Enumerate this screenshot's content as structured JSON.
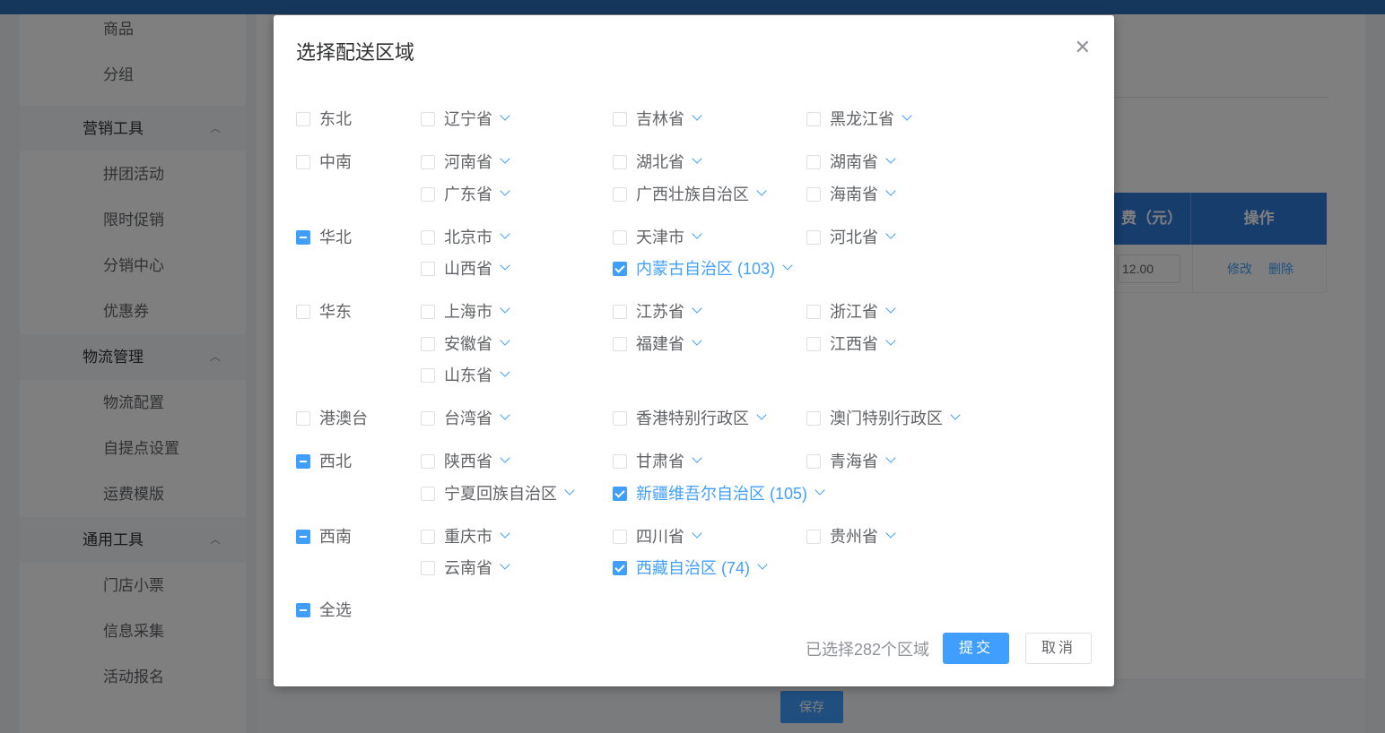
{
  "sidebar": {
    "items": [
      {
        "label": "商品",
        "type": "item"
      },
      {
        "label": "分组",
        "type": "item"
      },
      {
        "label": "营销工具",
        "type": "group"
      },
      {
        "label": "拼团活动",
        "type": "item"
      },
      {
        "label": "限时促销",
        "type": "item"
      },
      {
        "label": "分销中心",
        "type": "item"
      },
      {
        "label": "优惠券",
        "type": "item"
      },
      {
        "label": "物流管理",
        "type": "group"
      },
      {
        "label": "物流配置",
        "type": "item"
      },
      {
        "label": "自提点设置",
        "type": "item"
      },
      {
        "label": "运费模版",
        "type": "item"
      },
      {
        "label": "通用工具",
        "type": "group"
      },
      {
        "label": "门店小票",
        "type": "item"
      },
      {
        "label": "信息采集",
        "type": "item"
      },
      {
        "label": "活动报名",
        "type": "item"
      }
    ]
  },
  "table": {
    "header_price": "费（元）",
    "header_ops": "操作",
    "price_value": "12.00",
    "edit_label": "修改",
    "delete_label": "删除"
  },
  "footer": {
    "save_label": "保存"
  },
  "dialog": {
    "title": "选择配送区域",
    "close_icon": "close-icon",
    "regions": [
      {
        "name": "东北",
        "state": "unchecked",
        "rows": [
          [
            {
              "name": "辽宁省",
              "checked": false
            },
            {
              "name": "吉林省",
              "checked": false
            },
            {
              "name": "黑龙江省",
              "checked": false
            }
          ]
        ]
      },
      {
        "name": "中南",
        "state": "unchecked",
        "rows": [
          [
            {
              "name": "河南省",
              "checked": false
            },
            {
              "name": "湖北省",
              "checked": false
            },
            {
              "name": "湖南省",
              "checked": false
            }
          ],
          [
            {
              "name": "广东省",
              "checked": false
            },
            {
              "name": "广西壮族自治区",
              "checked": false
            },
            {
              "name": "海南省",
              "checked": false
            }
          ]
        ]
      },
      {
        "name": "华北",
        "state": "indeterminate",
        "rows": [
          [
            {
              "name": "北京市",
              "checked": false
            },
            {
              "name": "天津市",
              "checked": false
            },
            {
              "name": "河北省",
              "checked": false
            }
          ],
          [
            {
              "name": "山西省",
              "checked": false
            },
            {
              "name": "内蒙古自治区 (103)",
              "checked": true
            }
          ]
        ]
      },
      {
        "name": "华东",
        "state": "unchecked",
        "rows": [
          [
            {
              "name": "上海市",
              "checked": false
            },
            {
              "name": "江苏省",
              "checked": false
            },
            {
              "name": "浙江省",
              "checked": false
            }
          ],
          [
            {
              "name": "安徽省",
              "checked": false
            },
            {
              "name": "福建省",
              "checked": false
            },
            {
              "name": "江西省",
              "checked": false
            }
          ],
          [
            {
              "name": "山东省",
              "checked": false
            }
          ]
        ]
      },
      {
        "name": "港澳台",
        "state": "unchecked",
        "rows": [
          [
            {
              "name": "台湾省",
              "checked": false
            },
            {
              "name": "香港特别行政区",
              "checked": false
            },
            {
              "name": "澳门特别行政区",
              "checked": false
            }
          ]
        ]
      },
      {
        "name": "西北",
        "state": "indeterminate",
        "rows": [
          [
            {
              "name": "陕西省",
              "checked": false
            },
            {
              "name": "甘肃省",
              "checked": false
            },
            {
              "name": "青海省",
              "checked": false
            }
          ],
          [
            {
              "name": "宁夏回族自治区",
              "checked": false
            },
            {
              "name": "新疆维吾尔自治区 (105)",
              "checked": true
            }
          ]
        ]
      },
      {
        "name": "西南",
        "state": "indeterminate",
        "rows": [
          [
            {
              "name": "重庆市",
              "checked": false
            },
            {
              "name": "四川省",
              "checked": false
            },
            {
              "name": "贵州省",
              "checked": false
            }
          ],
          [
            {
              "name": "云南省",
              "checked": false
            },
            {
              "name": "西藏自治区 (74)",
              "checked": true
            }
          ]
        ]
      }
    ],
    "select_all": {
      "label": "全选",
      "state": "indeterminate"
    },
    "summary": "已选择282个区域",
    "submit_label": "提交",
    "cancel_label": "取消"
  }
}
